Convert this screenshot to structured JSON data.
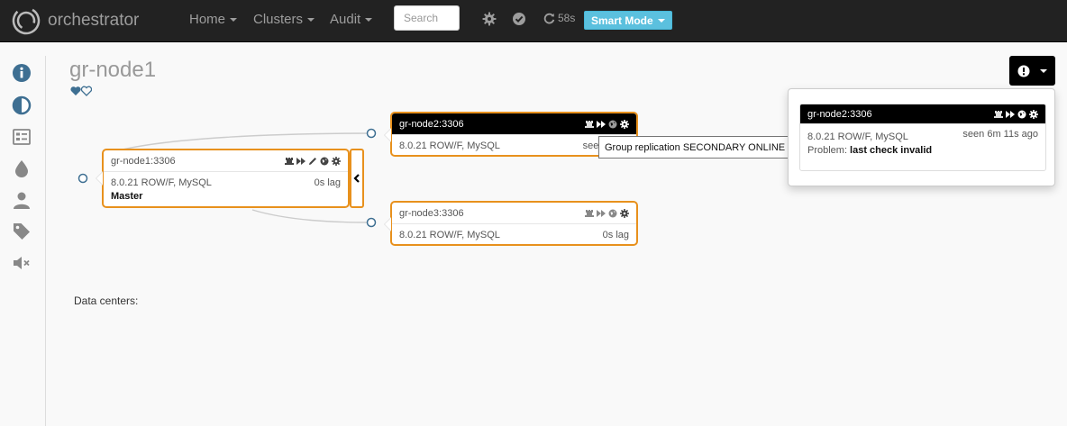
{
  "nav": {
    "brand": "orchestrator",
    "menu": [
      {
        "label": "Home"
      },
      {
        "label": "Clusters"
      },
      {
        "label": "Audit"
      }
    ],
    "search_placeholder": "Search",
    "refresh_countdown": "58s",
    "smart_mode": "Smart Mode"
  },
  "sidebar": {
    "icons": [
      "info-icon",
      "contrast-icon",
      "list-icon",
      "drop-icon",
      "user-icon",
      "tag-icon",
      "mute-icon"
    ],
    "accent": "#3e6f92"
  },
  "page": {
    "title": "gr-node1",
    "data_centers_label": "Data centers:"
  },
  "nodes": {
    "primary": {
      "name": "gr-node1:3306",
      "version": "8.0.21 ROW/F, MySQL",
      "lag": "0s lag",
      "role": "Master"
    },
    "node2": {
      "name": "gr-node2:3306",
      "version": "8.0.21 ROW/F, MySQL",
      "seen": "seen 6m 1"
    },
    "node3": {
      "name": "gr-node3:3306",
      "version": "8.0.21 ROW/F, MySQL",
      "lag": "0s lag"
    }
  },
  "tooltip": "Group replication SECONDARY ONLINE",
  "problems": {
    "node": {
      "name": "gr-node2:3306",
      "version": "8.0.21 ROW/F, MySQL",
      "seen": "seen 6m 11s ago",
      "problem_label": "Problem:",
      "problem_value": "last check invalid"
    }
  },
  "colors": {
    "navbar": "#222222",
    "node_border": "#e8911d",
    "smart_mode": "#5bc0de",
    "link_dot": "#3e6f92"
  }
}
